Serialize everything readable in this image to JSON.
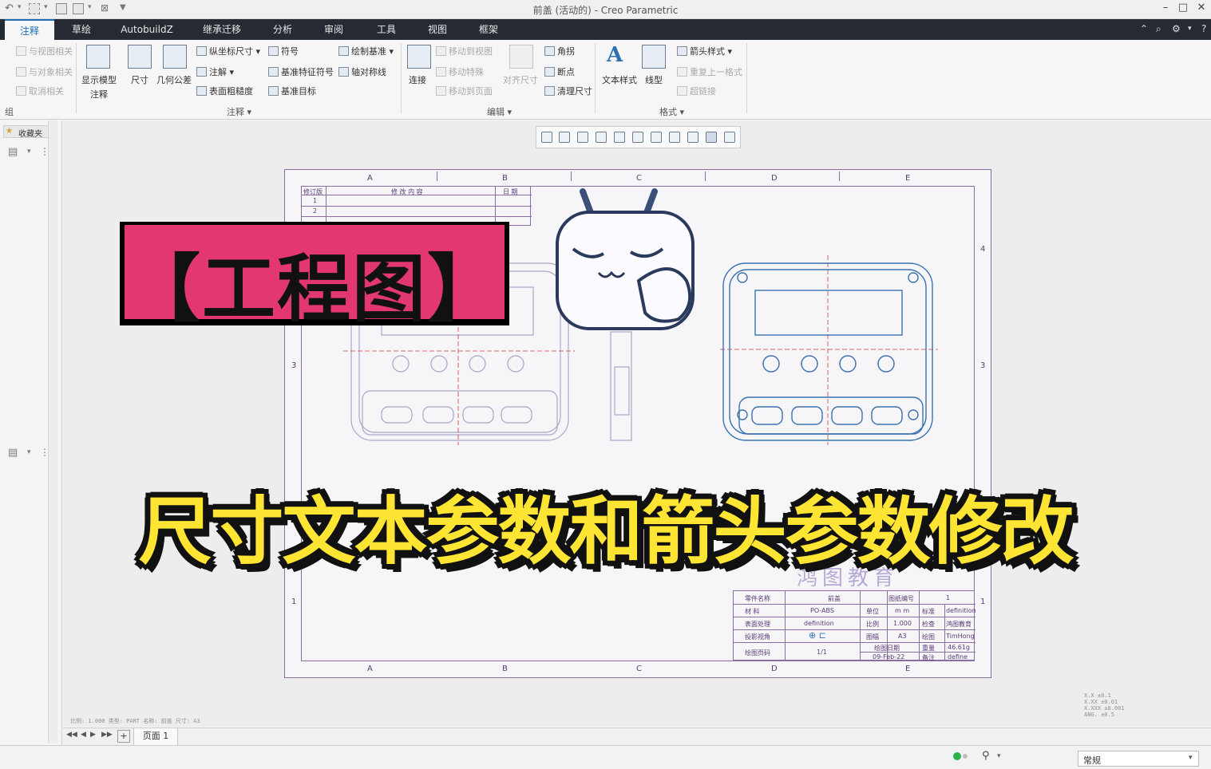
{
  "window": {
    "title": "前盖 (活动的) - Creo Parametric"
  },
  "tabs": [
    "注释",
    "草绘",
    "AutobuildZ",
    "继承迁移",
    "分析",
    "审阅",
    "工具",
    "视图",
    "框架"
  ],
  "ribbon": {
    "group_left": {
      "items": [
        "与视图相关",
        "与对象相关",
        "取消相关"
      ],
      "label": "组"
    },
    "show_model": {
      "line1": "显示模型",
      "line2": "注释"
    },
    "dimension": "尺寸",
    "gtol": "几何公差",
    "ordinate_dim": "纵坐标尺寸",
    "note": "注解",
    "surface_finish": "表面粗糙度",
    "symbol": "符号",
    "datum_feature": "基准特征符号",
    "datum_target": "基准目标",
    "draw_datum": "绘制基准",
    "axis_symmetry": "轴对称线",
    "annotate_label": "注释",
    "move_to_view": "移动到视图",
    "move_to_feature": "移动特殊",
    "move_to_page": "移动到页面",
    "connect": "连接",
    "align_dim": "对齐尺寸",
    "angle": "角拐",
    "breakpoint": "断点",
    "cleanup_dim": "清理尺寸",
    "edit_label": "编辑",
    "text_style": "文本样式",
    "line_style": "线型",
    "arrow_style": "箭头样式",
    "repeat_format": "重复上一格式",
    "hyperlink": "超链接",
    "format_label": "格式"
  },
  "sidebar": {
    "favorites": "收藏夹"
  },
  "drawing": {
    "zones_top": [
      "A",
      "B",
      "C",
      "D",
      "E"
    ],
    "zones_side": [
      "4",
      "3",
      "1"
    ],
    "rev_table": {
      "col1": "修订版",
      "col2": "修 改 内 容",
      "col3": "日 期",
      "rows": [
        "1",
        "2"
      ]
    },
    "title_block": {
      "part_name_label": "零件名称",
      "part_name": "前盖",
      "drawing_no_label": "图纸编号",
      "drawing_no": "1",
      "material_label": "材 料",
      "material": "PO-ABS",
      "unit_label": "单位",
      "unit": "m m",
      "std_label": "标准",
      "std": "definition",
      "surface_label": "表面处理",
      "surface": "definition",
      "scale_label": "比例",
      "scale": "1.000",
      "check_label": "检查",
      "check": "鸿图教育",
      "proj_label": "投影视角",
      "size_label": "图幅",
      "size": "A3",
      "drawn_label": "绘图",
      "drawn": "TimHong",
      "page_label": "绘图页码",
      "page": "1/1",
      "date_label": "绘图日期",
      "date": "09-Feb-22",
      "weight_label": "重量",
      "weight": "46.61g",
      "note_label": "备注",
      "note": "define"
    },
    "watermark": "鸿图教育",
    "footer_info": "比例: 1.000   类型: PART   名称: 前盖   尺寸: A3",
    "tolerance": [
      "X.X   ±0.1",
      "X.XX  ±0.01",
      "X.XXX ±0.001",
      "ANG.  ±0.5"
    ]
  },
  "overlay": {
    "title": "【工程图】",
    "subtitle": "尺寸文本参数和箭头参数修改"
  },
  "pages": {
    "current": "页面 1"
  },
  "status": {
    "filter": "常规"
  }
}
